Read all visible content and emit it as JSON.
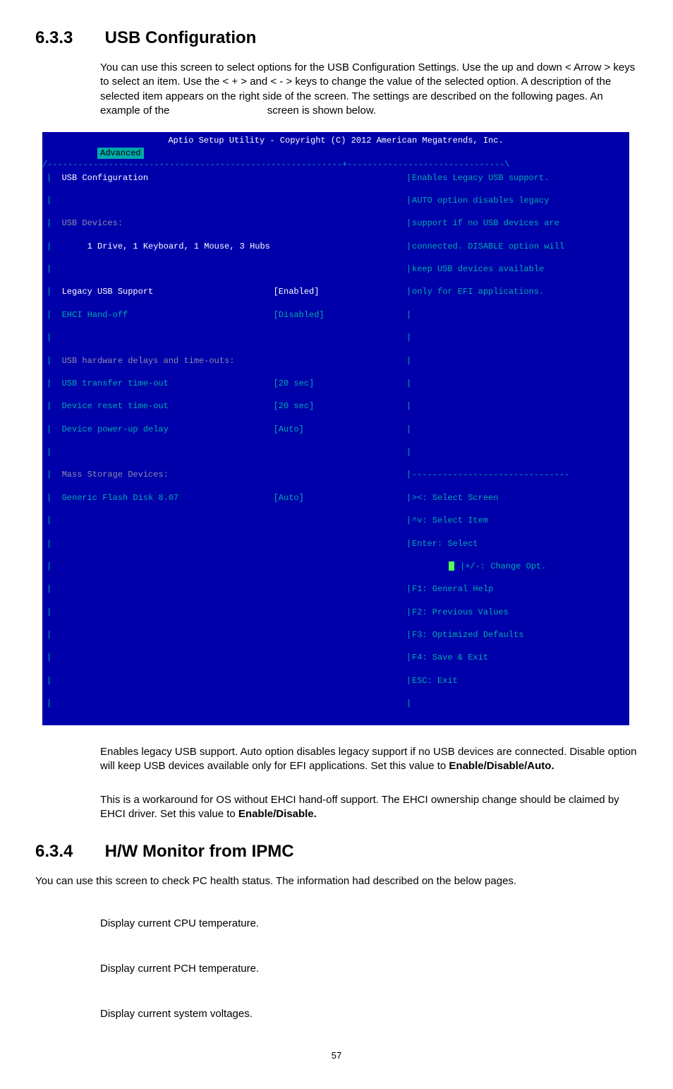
{
  "section1": {
    "number": "6.3.3",
    "title": "USB Configuration",
    "intro": "You can use this screen to select options for the USB Configuration Settings. Use the up and down < Arrow > keys to select an item. Use the < + > and < - > keys to change the value of the selected option. A description of the selected item appears on the right side of the screen. The settings are described on the following pages. An example of the",
    "intro_tail": "screen is shown below."
  },
  "bios": {
    "header": "Aptio Setup Utility - Copyright (C) 2012 American Megatrends, Inc.",
    "tab": "Advanced",
    "top_divider": "/----------------------------------------------------------+-------------------------------\\",
    "left": {
      "title": "USB Configuration",
      "devices_label": "USB Devices:",
      "devices_value": "1 Drive, 1 Keyboard, 1 Mouse, 3 Hubs",
      "rows": [
        {
          "label": "Legacy USB Support",
          "value": "[Enabled]",
          "sel": true
        },
        {
          "label": "EHCI Hand-off",
          "value": "[Disabled]"
        }
      ],
      "timeouts_header": "USB hardware delays and time-outs:",
      "timeouts": [
        {
          "label": "USB transfer time-out",
          "value": "[20 sec]"
        },
        {
          "label": "Device reset time-out",
          "value": "[20 sec]"
        },
        {
          "label": "Device power-up delay",
          "value": "[Auto]"
        }
      ],
      "mass_header": "Mass Storage Devices:",
      "mass": [
        {
          "label": "Generic Flash Disk 8.07",
          "value": "[Auto]"
        }
      ]
    },
    "right": {
      "help": [
        "Enables Legacy USB support.",
        "AUTO option disables legacy",
        "support if no USB devices are",
        "connected. DISABLE option will",
        "keep USB devices available",
        "only for EFI applications."
      ],
      "mid_divider": "-------------------------------",
      "keys": [
        "><: Select Screen",
        "^v: Select Item",
        "Enter: Select",
        "+/-: Change Opt.",
        "F1: General Help",
        "F2: Previous Values",
        "F3: Optimized Defaults",
        "F4: Save & Exit",
        "ESC: Exit"
      ]
    }
  },
  "opt1": {
    "text_a": "Enables legacy USB support. Auto option disables legacy support if no USB devices are connected. Disable option will keep USB devices available only for EFI applications. Set this value to ",
    "bold": "Enable/Disable/Auto."
  },
  "opt2": {
    "text_a": "This is a workaround for OS without EHCI hand-off support. The EHCI ownership change should be claimed by EHCI driver. Set this value to ",
    "bold": "Enable/Disable."
  },
  "section2": {
    "number": "6.3.4",
    "title": "H/W Monitor from IPMC",
    "intro": "You can use this screen to check PC health status. The information had described on the below pages.",
    "items": [
      "Display current CPU temperature.",
      "Display current PCH temperature.",
      "Display current system voltages."
    ]
  },
  "page_number": "57"
}
